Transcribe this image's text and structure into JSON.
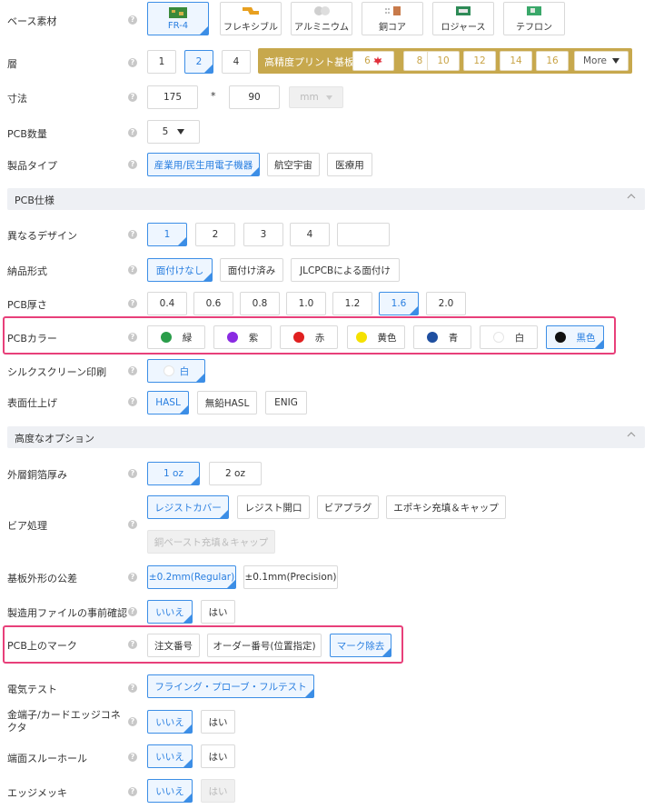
{
  "base_material": {
    "label": "ベース素材",
    "options": [
      "FR-4",
      "フレキシブル",
      "アルミニウム",
      "銅コア",
      "ロジャース",
      "テフロン"
    ]
  },
  "layers": {
    "label": "層",
    "options": [
      "1",
      "2",
      "4"
    ],
    "hdi_label": "高精度プリント基板",
    "hdi_options": [
      "6",
      "8",
      "10",
      "12",
      "14",
      "16"
    ],
    "more_label": "More"
  },
  "dimensions": {
    "label": "寸法",
    "width": "175",
    "separator": "*",
    "height": "90",
    "unit": "mm"
  },
  "pcb_qty": {
    "label": "PCB数量",
    "value": "5"
  },
  "product_type": {
    "label": "製品タイプ",
    "options": [
      "産業用/民生用電子機器",
      "航空宇宙",
      "医療用"
    ]
  },
  "section_spec": {
    "title": "PCB仕様"
  },
  "designs": {
    "label": "異なるデザイン",
    "options": [
      "1",
      "2",
      "3",
      "4",
      ""
    ]
  },
  "delivery": {
    "label": "納品形式",
    "options": [
      "面付けなし",
      "面付け済み",
      "JLCPCBによる面付け"
    ]
  },
  "thickness": {
    "label": "PCB厚さ",
    "options": [
      "0.4",
      "0.6",
      "0.8",
      "1.0",
      "1.2",
      "1.6",
      "2.0"
    ]
  },
  "color": {
    "label": "PCBカラー",
    "options": [
      "緑",
      "紫",
      "赤",
      "黄色",
      "青",
      "白",
      "黒色"
    ],
    "dot_colors": [
      "#2a9d4a",
      "#8a2be2",
      "#e02020",
      "#f5e100",
      "#1f4fa0",
      "#ffffff",
      "#111111"
    ]
  },
  "silk": {
    "label": "シルクスクリーン印刷",
    "value": "白"
  },
  "finish": {
    "label": "表面仕上げ",
    "options": [
      "HASL",
      "無鉛HASL",
      "ENIG"
    ]
  },
  "section_adv": {
    "title": "高度なオプション"
  },
  "copper": {
    "label": "外層銅箔厚み",
    "options": [
      "1 oz",
      "2 oz"
    ]
  },
  "via": {
    "label": "ビア処理",
    "options": [
      "レジストカバー",
      "レジスト開口",
      "ビアプラグ",
      "エポキシ充填＆キャップ",
      "銅ペースト充填＆キャップ"
    ]
  },
  "tolerance": {
    "label": "基板外形の公差",
    "options": [
      "±0.2mm(Regular)",
      "±0.1mm(Precision)"
    ]
  },
  "confirm": {
    "label": "製造用ファイルの事前確認",
    "options": [
      "いいえ",
      "はい"
    ]
  },
  "mark": {
    "label": "PCB上のマーク",
    "options": [
      "注文番号",
      "オーダー番号(位置指定)",
      "マーク除去"
    ]
  },
  "etest": {
    "label": "電気テスト",
    "value": "フライング・プローブ・フルテスト"
  },
  "gold": {
    "label": "金端子/カードエッジコネクタ",
    "options": [
      "いいえ",
      "はい"
    ]
  },
  "castellated": {
    "label": "端面スルーホール",
    "options": [
      "いいえ",
      "はい"
    ]
  },
  "edge": {
    "label": "エッジメッキ",
    "options": [
      "いいえ",
      "はい"
    ]
  },
  "help_glyph": "?"
}
